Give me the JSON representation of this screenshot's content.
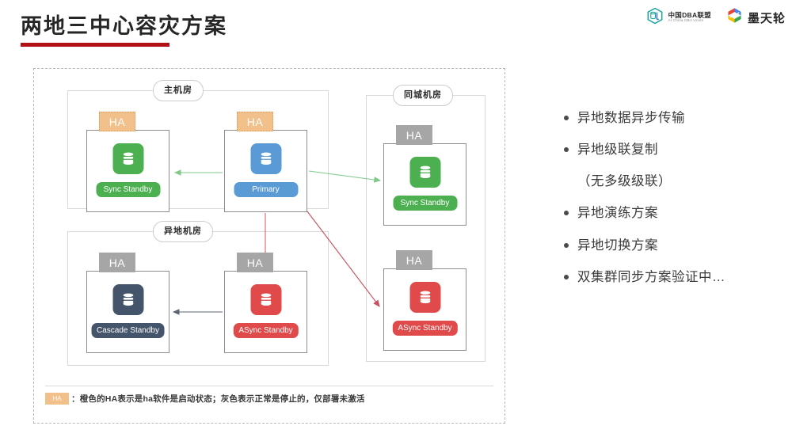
{
  "header": {
    "title": "两地三中心容灾方案",
    "underline_color": "#b01116"
  },
  "logos": [
    {
      "name": "中国DBA联盟",
      "subtitle": "AI China DBA Union",
      "icon": "hexagon-db-icon",
      "color": "#1aa6a0"
    },
    {
      "name": "墨天轮",
      "subtitle": "",
      "icon": "modb-icon",
      "color": "#3b7ddd"
    }
  ],
  "diagram": {
    "rooms": [
      {
        "id": "main",
        "label": "主机房"
      },
      {
        "id": "samecity",
        "label": "同城机房"
      },
      {
        "id": "remote",
        "label": "异地机房"
      }
    ],
    "nodes": [
      {
        "id": "sync-main",
        "role": "Sync Standby",
        "ha": "HA",
        "ha_state": "active",
        "color": "#4caf50",
        "room": "main"
      },
      {
        "id": "primary",
        "role": "Primary",
        "ha": "HA",
        "ha_state": "active",
        "color": "#5b9bd5",
        "room": "main"
      },
      {
        "id": "sync-city",
        "role": "Sync Standby",
        "ha": "HA",
        "ha_state": "inactive",
        "color": "#4caf50",
        "room": "samecity"
      },
      {
        "id": "cascade",
        "role": "Cascade Standby",
        "ha": "HA",
        "ha_state": "inactive",
        "color": "#44546a",
        "room": "remote"
      },
      {
        "id": "async-remote",
        "role": "ASync Standby",
        "ha": "HA",
        "ha_state": "inactive",
        "color": "#e04a4a",
        "room": "remote"
      },
      {
        "id": "async-city",
        "role": "ASync Standby",
        "ha": "HA",
        "ha_state": "inactive",
        "color": "#e04a4a",
        "room": "samecity"
      }
    ],
    "arrows": [
      {
        "id": "primary-to-sync-main",
        "from": "primary",
        "to": "sync-main",
        "color": "#7fc98a",
        "style": "sync"
      },
      {
        "id": "primary-to-sync-city",
        "from": "primary",
        "to": "sync-city",
        "color": "#7fc98a",
        "style": "sync"
      },
      {
        "id": "primary-to-async-remote",
        "from": "primary",
        "to": "async-remote",
        "color": "#e0616d",
        "style": "async"
      },
      {
        "id": "primary-to-async-city",
        "from": "primary",
        "to": "async-city",
        "color": "#c9505c",
        "style": "async"
      },
      {
        "id": "async-remote-to-cascade",
        "from": "async-remote",
        "to": "cascade",
        "color": "#5a6470",
        "style": "cascade"
      }
    ],
    "legend": {
      "badge": "HA",
      "badge_color": "#f2c08a",
      "note": "：橙色的HA表示是ha软件是启动状态；灰色表示正常是停止的，仅部署未激活"
    }
  },
  "bullets": [
    {
      "text": "异地数据异步传输",
      "dot": true
    },
    {
      "text": "异地级联复制",
      "dot": true
    },
    {
      "text": "（无多级级联）",
      "dot": false
    },
    {
      "text": "异地演练方案",
      "dot": true
    },
    {
      "text": "异地切换方案",
      "dot": true
    },
    {
      "text": "双集群同步方案验证中…",
      "dot": true
    }
  ]
}
